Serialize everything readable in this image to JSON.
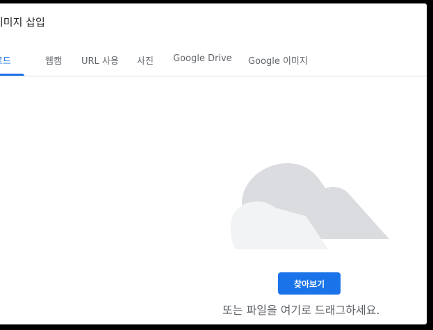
{
  "dialog": {
    "title": "이미지 삽입"
  },
  "tabs": [
    {
      "label": "업로드"
    },
    {
      "label": "웹캠"
    },
    {
      "label": "URL 사용"
    },
    {
      "label": "사진"
    },
    {
      "label": "Google Drive"
    },
    {
      "label": "Google 이미지"
    }
  ],
  "upload": {
    "browse_label": "찾아보기",
    "drag_text": "또는 파일을 여기로 드래그하세요."
  },
  "colors": {
    "accent": "#1a73e8",
    "cloud_back": "#dadce0",
    "cloud_front": "#f1f3f4"
  },
  "icons": {
    "illustration": "cloud-icon"
  }
}
